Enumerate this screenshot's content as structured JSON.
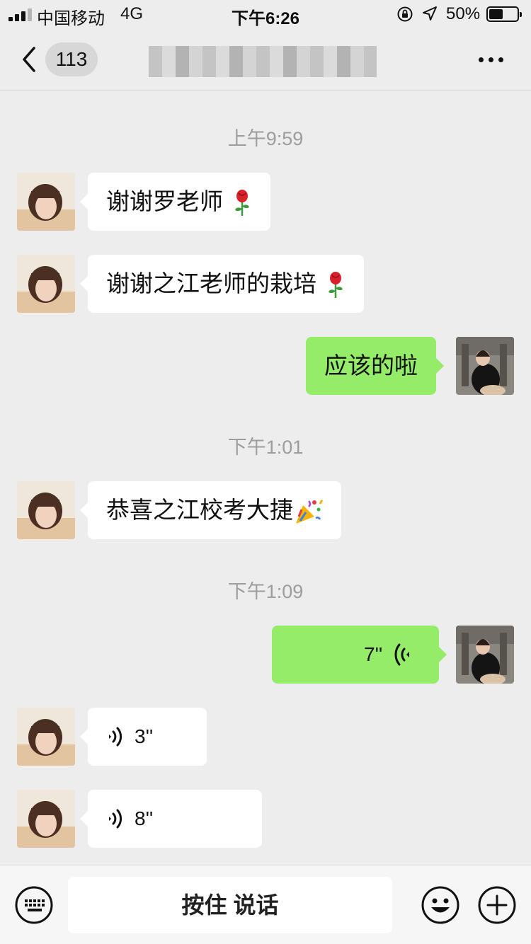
{
  "status_bar": {
    "carrier": "中国移动",
    "network": "4G",
    "time": "下午6:26",
    "battery_percent_text": "50%",
    "battery_level": 0.5,
    "signal_bars_on": 3,
    "signal_bars_total": 4,
    "icons": [
      "orientation-lock-icon",
      "location-arrow-icon",
      "battery-icon"
    ]
  },
  "nav": {
    "back_label": "back-chevron-icon",
    "unread_count": "113",
    "title_pixelated": true,
    "more_label": "more-icon"
  },
  "chat": {
    "timestamps": [
      "上午9:59",
      "下午1:01",
      "下午1:09"
    ],
    "messages": [
      {
        "from": "other",
        "text": "谢谢罗老师",
        "emoji": "rose-emoji"
      },
      {
        "from": "other",
        "text": "谢谢之江老师的栽培",
        "emoji": "rose-emoji"
      },
      {
        "from": "self",
        "text": "应该的啦"
      },
      {
        "from": "other",
        "text": "恭喜之江校考大捷",
        "emoji": "party-popper-emoji"
      },
      {
        "from": "self",
        "type": "voice",
        "duration": "7''"
      },
      {
        "from": "other",
        "type": "voice",
        "duration": "3''"
      },
      {
        "from": "other",
        "type": "voice",
        "duration": "8''"
      }
    ]
  },
  "input_bar": {
    "hold_to_talk": "按住 说话",
    "icons": [
      "keyboard-icon",
      "emoji-face-icon",
      "plus-circle-icon"
    ]
  },
  "colors": {
    "background": "#ededed",
    "self_bubble": "#95ec69",
    "other_bubble": "#ffffff",
    "timestamp": "#9d9d9d"
  }
}
